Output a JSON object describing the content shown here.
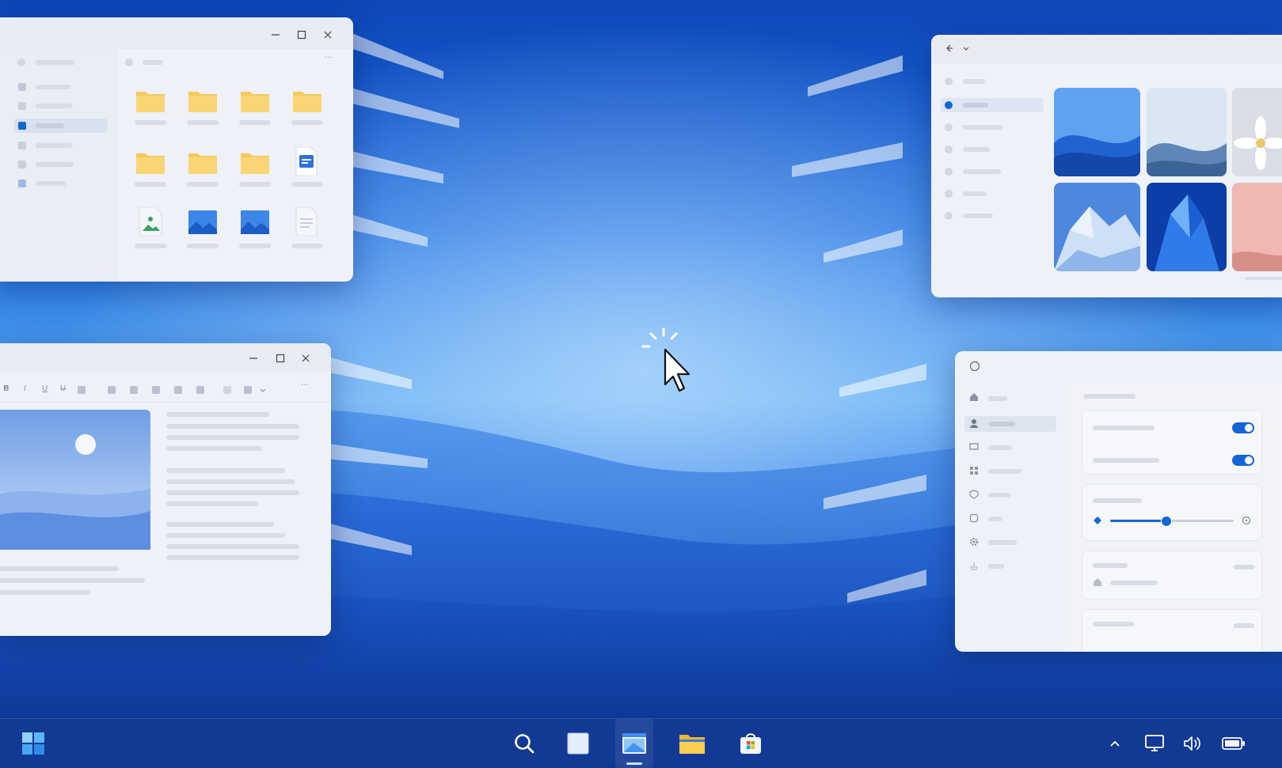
{
  "colors": {
    "accent": "#1565d8",
    "window_bg": "#eef1f7",
    "folder_yellow": "#f5c95a",
    "taskbar_bg": "#1e4a9e"
  },
  "explorer_window": {
    "icons": [
      "minimize-icon",
      "maximize-icon",
      "close-icon",
      "folder-icon",
      "document-icon",
      "image-file-icon",
      "picture-icon",
      "more-icon"
    ]
  },
  "editor_window": {
    "toolbar": {
      "bold": "B",
      "italic": "I",
      "underline": "U",
      "more": "···"
    }
  },
  "gallery_window": {
    "icons": [
      "back-icon",
      "chevron-down-icon"
    ]
  },
  "settings_window": {
    "toggle_1": true,
    "toggle_2": true,
    "slider_value": 0.45,
    "icons": [
      "home-icon",
      "account-icon",
      "devices-icon",
      "apps-icon",
      "privacy-icon",
      "update-icon",
      "gear-icon",
      "accessibility-icon"
    ]
  },
  "taskbar": {
    "items": [
      "start-icon",
      "search-icon",
      "task-view-icon",
      "browser-icon",
      "file-explorer-icon",
      "store-icon"
    ],
    "tray": [
      "chevron-up-icon",
      "display-icon",
      "volume-icon",
      "battery-icon"
    ]
  }
}
